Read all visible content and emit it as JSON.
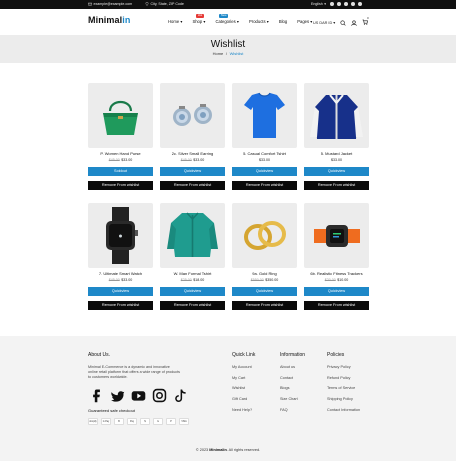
{
  "topbar": {
    "email": "example@example.com",
    "location": "City, State, ZIP Code",
    "language": "English",
    "social_icons": [
      "facebook-icon",
      "twitter-icon",
      "youtube-icon",
      "instagram-icon",
      "tiktok-icon"
    ]
  },
  "header": {
    "logo_main": "Minimal",
    "logo_accent": "in",
    "nav": [
      {
        "label": "Home",
        "badge": ""
      },
      {
        "label": "Shop",
        "badge": "Hot",
        "badge_color": "#e53935"
      },
      {
        "label": "Categories",
        "badge": "New",
        "badge_color": "#1e88c8"
      },
      {
        "label": "Products",
        "badge": ""
      },
      {
        "label": "Blog",
        "badge": ""
      },
      {
        "label": "Pages",
        "badge": ""
      }
    ],
    "currency": "US DAR ID",
    "cart_count": "0"
  },
  "banner": {
    "title": "Wishlist",
    "breadcrumb_home": "Home",
    "breadcrumb_sep": "/",
    "breadcrumb_current": "Wishlist"
  },
  "products": [
    {
      "name": "P. Women Hand Purse",
      "old_price": "$45.00",
      "new_price": "$33.00",
      "action": "Soldout",
      "remove": "Remove From wishlist",
      "image": "handbag"
    },
    {
      "name": "2c. Silver Small Earring",
      "old_price": "$45.00",
      "new_price": "$33.00",
      "action": "Quickview",
      "remove": "Remove From wishlist",
      "image": "earring"
    },
    {
      "name": "5. Casual Comfort Tshirt",
      "old_price": "",
      "new_price": "$33.00",
      "action": "Quickview",
      "remove": "Remove From wishlist",
      "image": "tshirt"
    },
    {
      "name": "5. Mustard Jacket",
      "old_price": "",
      "new_price": "$33.00",
      "action": "Quickview",
      "remove": "Remove From wishlist",
      "image": "jacket"
    },
    {
      "name": "7. Ultimate Smart Watch",
      "old_price": "$45.00",
      "new_price": "$33.00",
      "action": "Quickview",
      "remove": "Remove From wishlist",
      "image": "watch"
    },
    {
      "name": "W. Man Formal Tshirt",
      "old_price": "$25.00",
      "new_price": "$18.00",
      "action": "Quickview",
      "remove": "Remove From wishlist",
      "image": "shirt"
    },
    {
      "name": "9a. Gold Ring",
      "old_price": "$550.00",
      "new_price": "$350.00",
      "action": "Quickview",
      "remove": "Remove From wishlist",
      "image": "rings"
    },
    {
      "name": "6b. Realistic Fitness Trackers",
      "old_price": "$20.00",
      "new_price": "$10.00",
      "action": "Quickview",
      "remove": "Remove From wishlist",
      "image": "tracker"
    }
  ],
  "footer": {
    "about_title": "About Us.",
    "about_text": "Minimal E-Commerce is a dynamic and innovative online retail platform that offers a wide range of products to customers worldwide.",
    "secure_label": "Guaranteed safe checkout",
    "payments": [
      "shopify",
      "G Pay",
      "B",
      "Pay",
      "$",
      "G",
      "P",
      "VISA"
    ],
    "quick_title": "Quick Link",
    "quick_links": [
      "My Account",
      "My Cart",
      "Wishlist",
      "Gift Card",
      "Need Help?"
    ],
    "info_title": "Information",
    "info_links": [
      "About us",
      "Contact",
      "Blogs",
      "Size Chart",
      "FAQ"
    ],
    "policy_title": "Policies",
    "policy_links": [
      "Privacy Policy",
      "Refund Policy",
      "Terms of Service",
      "Shipping Policy",
      "Contact Information"
    ],
    "copy_prefix": "© 2023",
    "copy_brand": "Minimalin",
    "copy_suffix": ". All rights reserved."
  },
  "colors": {
    "accent": "#1e88c8",
    "dark": "#0a0a0a"
  }
}
